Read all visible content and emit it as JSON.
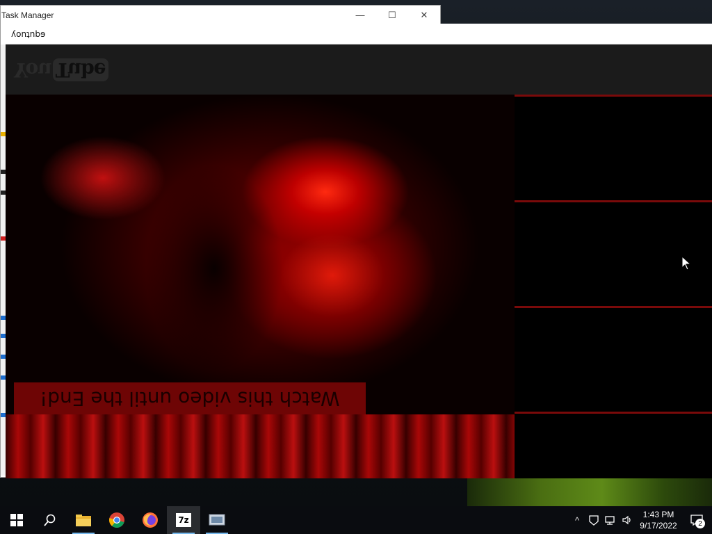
{
  "taskmgr": {
    "title": "Task Manager",
    "minimize": "—",
    "maximize": "☐",
    "close": "✕"
  },
  "prank": {
    "window_title": "ʎonʇnbɘ",
    "logo_you": "You",
    "logo_tube": "Tube",
    "caption": "Watch this video until the End!"
  },
  "taskbar": {
    "apps": [
      "start-icon",
      "search-icon",
      "file-explorer-icon",
      "chrome-icon",
      "firefox-icon",
      "7zip-icon",
      "prank-app-icon"
    ],
    "apps_7zip_label": "7z",
    "tray_chevron": "^",
    "time": "1:43 PM",
    "date": "9/17/2022",
    "notification_count": "2"
  },
  "colors": {
    "accent": "#76b9ed",
    "caption_bg": "#6e0505",
    "video_red": "#e01a0a"
  }
}
